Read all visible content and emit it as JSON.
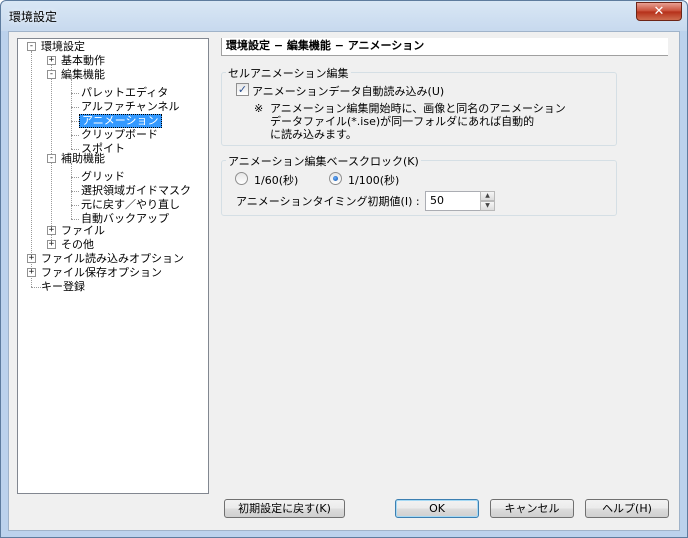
{
  "window": {
    "title": "環境設定",
    "close_glyph": "✕"
  },
  "tree": {
    "nodes": {
      "root": "環境設定",
      "basic": "基本動作",
      "edit": "編集機能",
      "palette_editor": "パレットエディタ",
      "alpha_channel": "アルファチャンネル",
      "animation": "アニメーション",
      "clipboard": "クリップボード",
      "spoit": "スポイト",
      "aux": "補助機能",
      "grid": "グリッド",
      "selection_guide": "選択領域ガイドマスク",
      "undo_redo": "元に戻す／やり直し",
      "auto_backup": "自動バックアップ",
      "file": "ファイル",
      "other": "その他",
      "file_load": "ファイル読み込みオプション",
      "file_save": "ファイル保存オプション",
      "key_reg": "キー登録"
    },
    "expander_plus": "+",
    "expander_minus": "-",
    "selected": "animation"
  },
  "panel": {
    "header": "環境設定 − 編集機能 − アニメーション",
    "cel_group": {
      "legend": "セルアニメーション編集",
      "auto_load_label": "アニメーションデータ自動読み込み(U)",
      "auto_load_checked": true,
      "note_marker": "※",
      "note_text": "アニメーション編集開始時に、画像と同名のアニメーション\nデータファイル(*.ise)が同一フォルダにあれば自動的\nに読み込みます。"
    },
    "clock_group": {
      "legend": "アニメーション編集ベースクロック(K)",
      "options": [
        "1/60(秒)",
        "1/100(秒)"
      ],
      "selected_index": 1,
      "timing_label": "アニメーションタイミング初期値(I) :",
      "timing_value": "50"
    }
  },
  "buttons": {
    "reset": "初期設定に戻す(K)",
    "ok": "OK",
    "cancel": "キャンセル",
    "help": "ヘルプ(H)"
  },
  "colors": {
    "selection": "#3399ff",
    "title_bar": "#c7d9ee",
    "close_button": "#c74b34"
  }
}
